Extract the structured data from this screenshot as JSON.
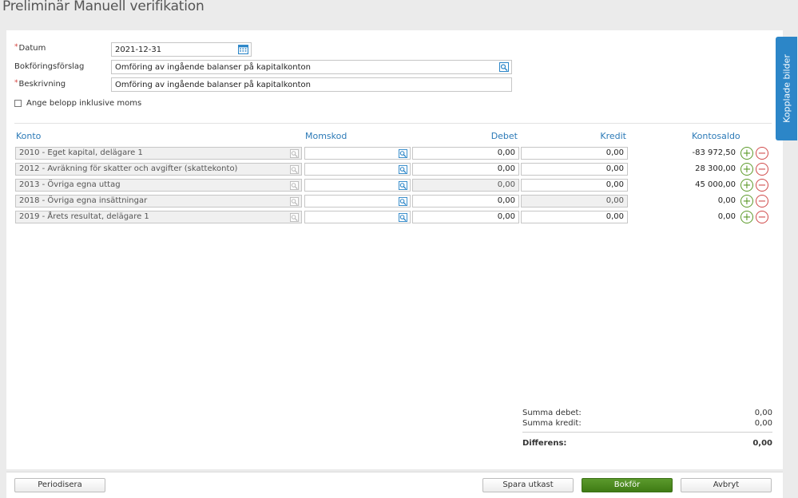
{
  "page": {
    "title": "Preliminär Manuell verifikation"
  },
  "form": {
    "date_label": "Datum",
    "date_value": "2021-12-31",
    "suggestion_label": "Bokföringsförslag",
    "suggestion_value": "Omföring av ingående balanser på kapitalkonton",
    "description_label": "Beskrivning",
    "description_value": "Omföring av ingående balanser på kapitalkonton",
    "vat_checkbox_label": "Ange belopp inklusive moms",
    "required_marker": "*"
  },
  "table": {
    "headers": {
      "konto": "Konto",
      "momskod": "Momskod",
      "debet": "Debet",
      "kredit": "Kredit",
      "kontosaldo": "Kontosaldo"
    },
    "rows": [
      {
        "konto": "2010 - Eget kapital, delägare 1",
        "momskod": "",
        "debet": "0,00",
        "kredit": "0,00",
        "saldo": "-83 972,50",
        "debet_disabled": false,
        "kredit_disabled": false
      },
      {
        "konto": "2012 - Avräkning för skatter och avgifter (skattekonto)",
        "momskod": "",
        "debet": "0,00",
        "kredit": "0,00",
        "saldo": "28 300,00",
        "debet_disabled": false,
        "kredit_disabled": false
      },
      {
        "konto": "2013 - Övriga egna uttag",
        "momskod": "",
        "debet": "0,00",
        "kredit": "0,00",
        "saldo": "45 000,00",
        "debet_disabled": true,
        "kredit_disabled": false
      },
      {
        "konto": "2018 - Övriga egna insättningar",
        "momskod": "",
        "debet": "0,00",
        "kredit": "0,00",
        "saldo": "0,00",
        "debet_disabled": false,
        "kredit_disabled": true
      },
      {
        "konto": "2019 - Årets resultat, delägare 1",
        "momskod": "",
        "debet": "0,00",
        "kredit": "0,00",
        "saldo": "0,00",
        "debet_disabled": false,
        "kredit_disabled": false
      }
    ],
    "add_symbol": "+",
    "remove_symbol": "−"
  },
  "summary": {
    "debet_label": "Summa debet:",
    "debet_value": "0,00",
    "kredit_label": "Summa kredit:",
    "kredit_value": "0,00",
    "diff_label": "Differens:",
    "diff_value": "0,00"
  },
  "footer": {
    "periodisera": "Periodisera",
    "spara_utkast": "Spara utkast",
    "bokfor": "Bokför",
    "avbryt": "Avbryt"
  },
  "side_tab": {
    "label": "Kopplade bilder"
  },
  "icons": {
    "calendar": "calendar-icon",
    "lookup": "lookup-icon",
    "add": "add-row-icon",
    "remove": "remove-row-icon"
  },
  "colors": {
    "accent": "#2c7ab7",
    "primary_button": "#4a8a1e",
    "side_tab": "#2c86c8",
    "remove": "#d04a4a",
    "add": "#5c9a2a"
  }
}
